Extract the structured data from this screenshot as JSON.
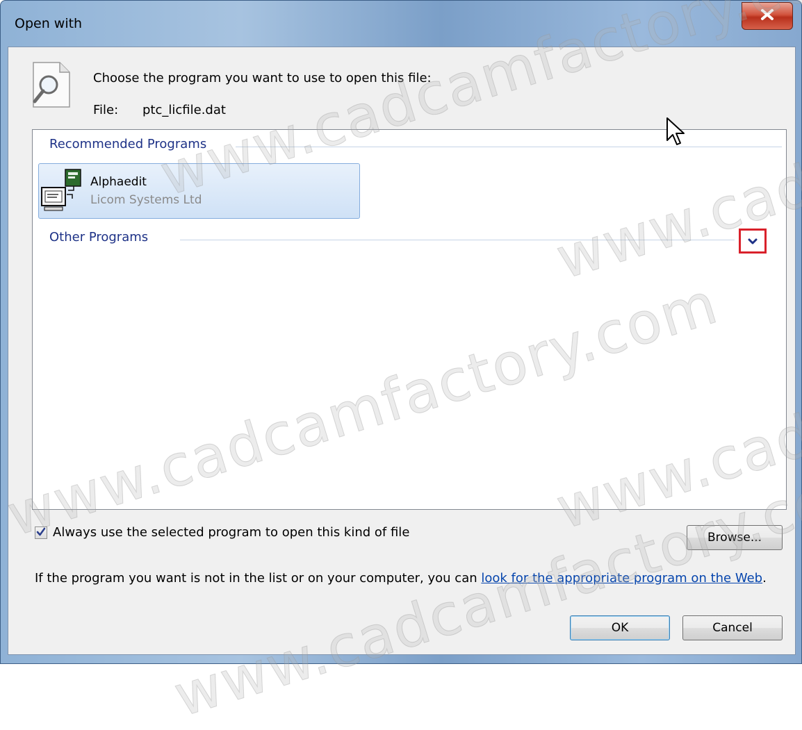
{
  "window": {
    "title": "Open with",
    "close_glyph": "x"
  },
  "header": {
    "prompt": "Choose the program you want to use to open this file:",
    "file_label": "File:",
    "file_name": "ptc_licfile.dat",
    "icon": "file-search-icon"
  },
  "groups": {
    "recommended": "Recommended Programs",
    "other": "Other Programs"
  },
  "programs": [
    {
      "name": "Alphaedit",
      "company": "Licom Systems Ltd",
      "icon": "alphaedit-app-icon"
    }
  ],
  "options": {
    "always_use_label": "Always use the selected program to open this kind of file",
    "always_use_checked": true
  },
  "footer": {
    "info_prefix": "If the program you want is not in the list or on your computer, you can ",
    "link_text": "look for the appropriate program on the Web",
    "info_suffix": "."
  },
  "buttons": {
    "browse": "Browse...",
    "ok": "OK",
    "cancel": "Cancel"
  },
  "colors": {
    "highlight_box": "#d9212b",
    "group_header": "#1e3287",
    "link": "#0645ad"
  }
}
